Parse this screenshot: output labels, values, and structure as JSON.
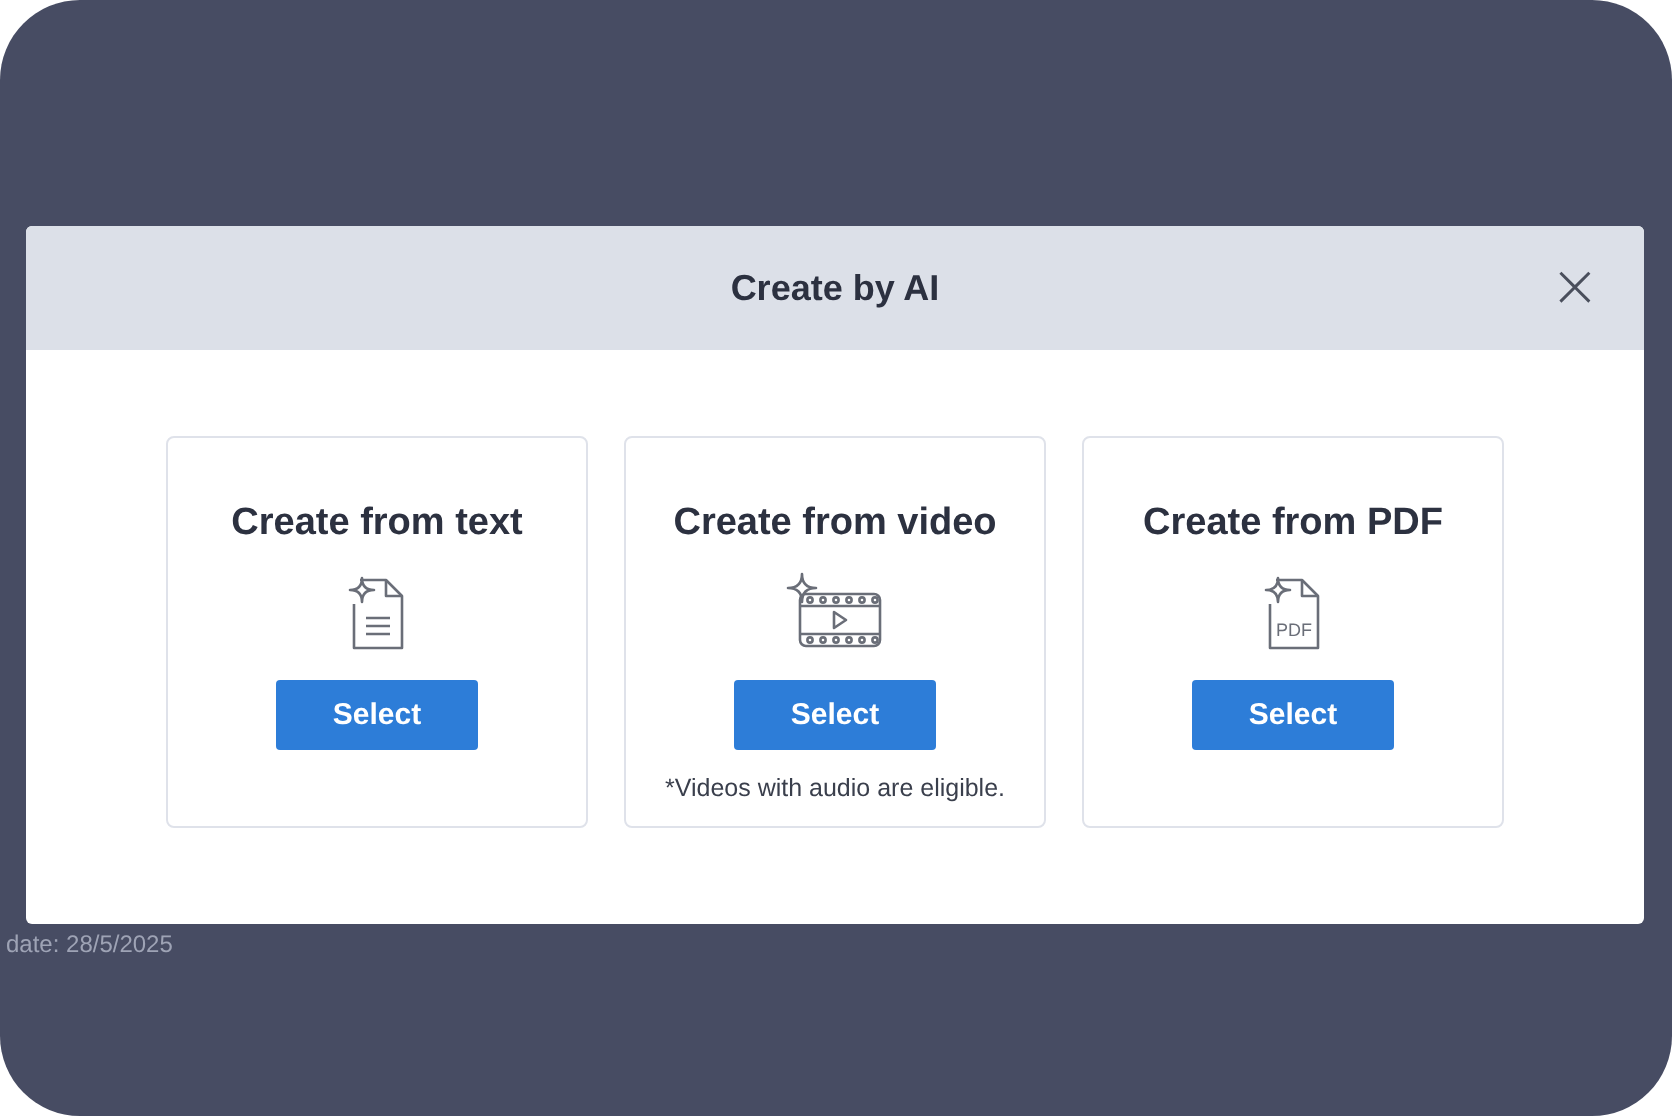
{
  "background": {
    "footer_text": "date: 28/5/2025"
  },
  "dialog": {
    "title": "Create by AI",
    "close": "×",
    "cards": [
      {
        "kind": "text",
        "title": "Create from text",
        "button": "Select"
      },
      {
        "kind": "video",
        "title": "Create from video",
        "button": "Select",
        "note": "*Videos with audio are eligible."
      },
      {
        "kind": "pdf",
        "title": "Create from PDF",
        "button": "Select",
        "icon_label": "PDF"
      }
    ]
  }
}
